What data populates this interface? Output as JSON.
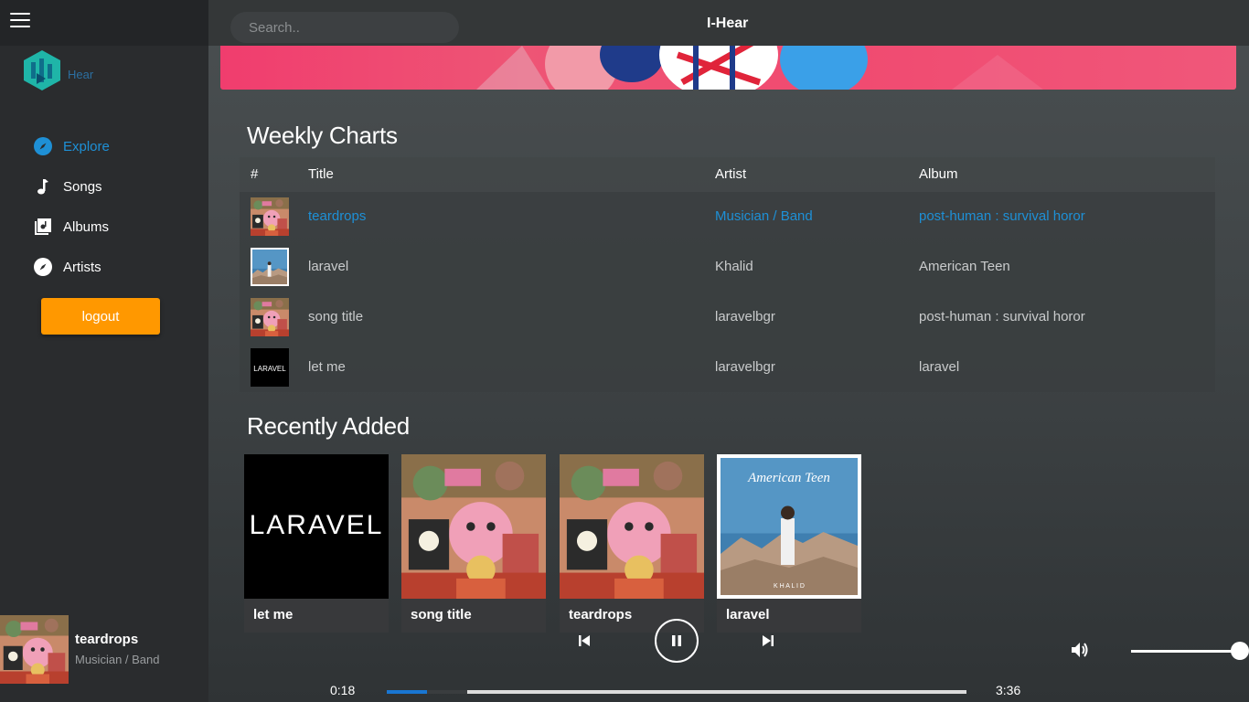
{
  "header": {
    "app_title": "I-Hear",
    "search_placeholder": "Search.."
  },
  "sidebar": {
    "logo_text": "Hear",
    "items": [
      {
        "label": "Explore",
        "icon": "compass-icon",
        "active": true
      },
      {
        "label": "Songs",
        "icon": "music-note-icon"
      },
      {
        "label": "Albums",
        "icon": "album-icon"
      },
      {
        "label": "Artists",
        "icon": "compass-icon"
      }
    ],
    "logout_label": "logout"
  },
  "weekly_charts": {
    "title": "Weekly Charts",
    "columns": [
      "#",
      "Title",
      "Artist",
      "Album"
    ],
    "rows": [
      {
        "title": "teardrops",
        "artist": "Musician / Band",
        "album": "post-human : survival horor",
        "art": "collage"
      },
      {
        "title": "laravel",
        "artist": "Khalid",
        "album": "American Teen",
        "art": "american-teen"
      },
      {
        "title": "song title",
        "artist": "laravelbgr",
        "album": "post-human : survival horor",
        "art": "collage"
      },
      {
        "title": "let me",
        "artist": "laravelbgr",
        "album": "laravel",
        "art": "laravel"
      }
    ]
  },
  "recently_added": {
    "title": "Recently Added",
    "cards": [
      {
        "name": "let me",
        "art": "laravel"
      },
      {
        "name": "song title",
        "art": "collage"
      },
      {
        "name": "teardrops",
        "art": "collage"
      },
      {
        "name": "laravel",
        "art": "american-teen"
      }
    ]
  },
  "cover_text": {
    "laravel_logo": "LARAVEL",
    "american_teen": "American Teen",
    "khalid": "K H A L I D"
  },
  "player": {
    "now_playing_title": "teardrops",
    "now_playing_artist": "Musician / Band",
    "current_time": "0:18",
    "total_time": "3:36",
    "progress_fraction": 0.07,
    "buffer_fraction": 0.14,
    "volume_fraction": 1.0,
    "state": "playing"
  },
  "colors": {
    "accent": "#1e90d6",
    "logout": "#ff9800",
    "banner": "#f04a70"
  }
}
